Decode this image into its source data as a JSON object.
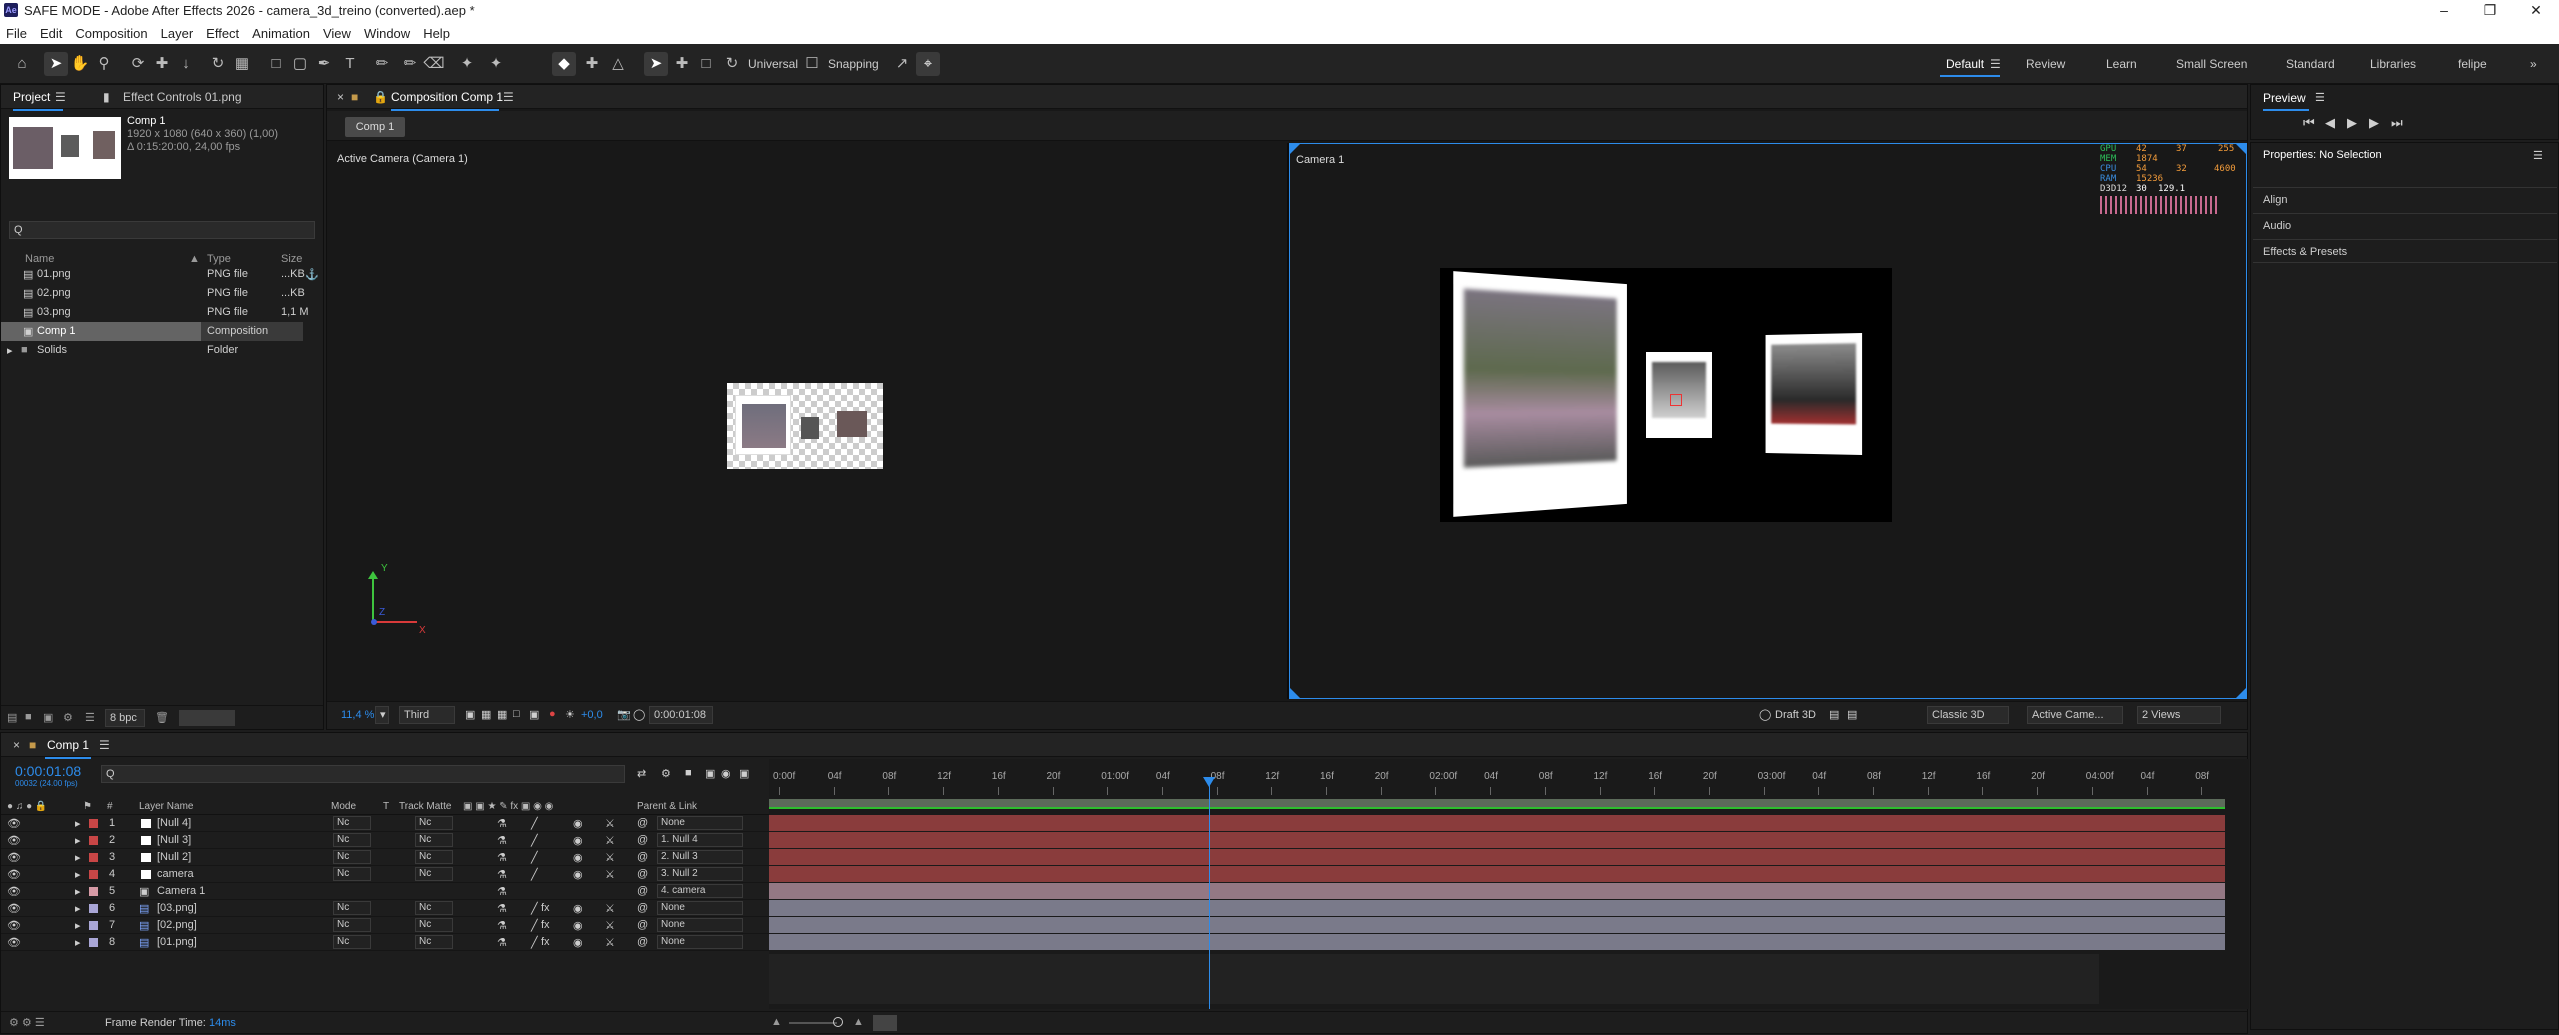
{
  "window": {
    "title": "SAFE MODE - Adobe After Effects 2026 - camera_3d_treino (converted).aep *",
    "app_icon": "Ae"
  },
  "menu": [
    "File",
    "Edit",
    "Composition",
    "Layer",
    "Effect",
    "Animation",
    "View",
    "Window",
    "Help"
  ],
  "toolbar": {
    "axis_mode": "Universal",
    "snapping": "Snapping"
  },
  "workspaces": [
    "Default",
    "Review",
    "Learn",
    "Small Screen",
    "Standard",
    "Libraries",
    "felipe"
  ],
  "project": {
    "tab": "Project",
    "effect_tab": "Effect Controls 01.png",
    "selected_name": "Comp 1",
    "info_dims": "1920 x 1080  (640 x 360) (1,00)",
    "info_dur": "Δ 0:15:20:00, 24,00 fps",
    "search_placeholder": "Q",
    "columns": {
      "name": "Name",
      "type": "Type",
      "size": "Size"
    },
    "items": [
      {
        "name": "01.png",
        "type": "PNG file",
        "size": "...KB"
      },
      {
        "name": "02.png",
        "type": "PNG file",
        "size": "...KB"
      },
      {
        "name": "03.png",
        "type": "PNG file",
        "size": "1,1 M"
      },
      {
        "name": "Comp 1",
        "type": "Composition",
        "size": ""
      },
      {
        "name": "Solids",
        "type": "Folder",
        "size": ""
      }
    ],
    "bpc": "8 bpc"
  },
  "composition": {
    "tab": "Composition Comp 1",
    "sub_tab": "Comp 1",
    "left_view_label": "Active Camera (Camera 1)",
    "right_view_label": "Camera 1",
    "zoom": "11,4 %",
    "resolution": "Third",
    "exposure": "+0,0",
    "timecode": "0:00:01:08",
    "renderer": "Draft 3D",
    "renderer_mode": "Classic 3D",
    "camera_view": "Active Came...",
    "views": "2 Views",
    "gpu_stats": {
      "labels": [
        "GPU",
        "MEM",
        "CPU",
        "RAM",
        "D3D12"
      ],
      "v1": [
        "42",
        "1874",
        "54",
        "15236",
        "30"
      ],
      "v2": [
        "37",
        "",
        "32",
        "",
        ""
      ],
      "v3": [
        "255",
        "",
        "4600",
        "",
        "129.1"
      ]
    },
    "axis": {
      "y": "Y",
      "z": "Z",
      "x": "X"
    }
  },
  "preview": {
    "title": "Preview"
  },
  "properties": {
    "title": "Properties: No Selection",
    "sections": [
      "Align",
      "Audio",
      "Effects & Presets"
    ]
  },
  "timeline": {
    "tab": "Comp 1",
    "timecode": "0:00:01:08",
    "timecode_sub": "00032 (24.00 fps)",
    "search_placeholder": "Q",
    "columns": {
      "num": "#",
      "layer_name": "Layer Name",
      "mode": "Mode",
      "t": "T",
      "track_matte": "Track Matte",
      "parent": "Parent & Link"
    },
    "ruler": [
      "0:00f",
      "04f",
      "08f",
      "12f",
      "16f",
      "20f",
      "01:00f",
      "04f",
      "08f",
      "12f",
      "16f",
      "20f",
      "02:00f",
      "04f",
      "08f",
      "12f",
      "16f",
      "20f",
      "03:00f",
      "04f",
      "08f",
      "12f",
      "16f",
      "20f",
      "04:00f",
      "04f",
      "08f"
    ],
    "playhead_fraction": 0.302,
    "layers": [
      {
        "num": "1",
        "name": "[Null 4]",
        "mode": "Nc",
        "matte": "Nc",
        "parent": "None",
        "label": "#c84646",
        "kind": "null"
      },
      {
        "num": "2",
        "name": "[Null 3]",
        "mode": "Nc",
        "matte": "Nc",
        "parent": "1. Null 4",
        "label": "#c84646",
        "kind": "null"
      },
      {
        "num": "3",
        "name": "[Null 2]",
        "mode": "Nc",
        "matte": "Nc",
        "parent": "2. Null 3",
        "label": "#c84646",
        "kind": "null"
      },
      {
        "num": "4",
        "name": "camera",
        "mode": "Nc",
        "matte": "Nc",
        "parent": "3. Null 2",
        "label": "#c84646",
        "kind": "null"
      },
      {
        "num": "5",
        "name": "Camera 1",
        "mode": "",
        "matte": "",
        "parent": "4. camera",
        "label": "#d69aa5",
        "kind": "camera"
      },
      {
        "num": "6",
        "name": "[03.png]",
        "mode": "Nc",
        "matte": "Nc",
        "parent": "None",
        "label": "#a9a6d6",
        "kind": "footage"
      },
      {
        "num": "7",
        "name": "[02.png]",
        "mode": "Nc",
        "matte": "Nc",
        "parent": "None",
        "label": "#a9a6d6",
        "kind": "footage"
      },
      {
        "num": "8",
        "name": "[01.png]",
        "mode": "Nc",
        "matte": "Nc",
        "parent": "None",
        "label": "#a9a6d6",
        "kind": "footage"
      }
    ],
    "frame_render_label": "Frame Render Time:",
    "frame_render_value": "14ms"
  },
  "colors": {
    "accent": "#2d8ceb",
    "null_bar": "#8a3c3c",
    "footage_bar": "#7a7a8a",
    "work_area": "#5a6a5a"
  }
}
